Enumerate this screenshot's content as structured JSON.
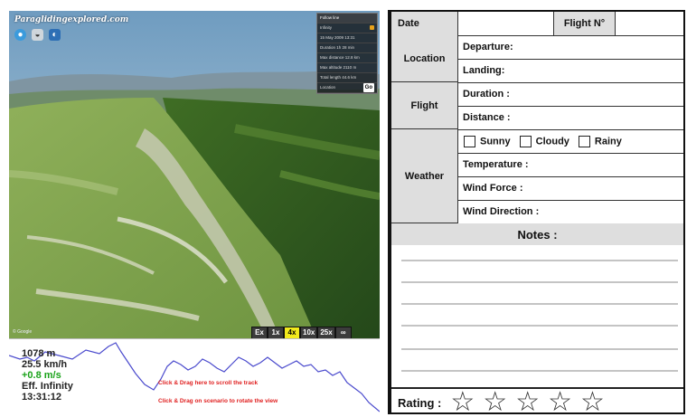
{
  "viewer": {
    "logo_text": "Paraglidingexplored.com",
    "info_panel": {
      "rows": [
        "Follow line",
        "Infinity",
        "15 May 2009 13:31",
        "Duration 1h 28 min",
        "Max distance 12.8 km",
        "Max altitude 2110 m",
        "Total length 44.6 km"
      ],
      "location_label": "Location",
      "location_button": "Go"
    },
    "copyright": "© Google",
    "speed_buttons": [
      "Ex",
      "1x",
      "4x",
      "10x",
      "25x",
      "∞"
    ],
    "speed_active_index": 2,
    "colors": {
      "sky": "#a8c3d8",
      "terrain_green": "#5c8a2c",
      "active_speed": "#f2ea1c"
    }
  },
  "profile": {
    "stats": {
      "altitude": "1078 m",
      "speed": "25.5 km/h",
      "vario": "+0.8 m/s",
      "efficiency": "Eff. Infinity",
      "time": "13:31:12"
    },
    "hint_scroll": "Click & Drag here to scroll the track",
    "hint_rotate": "Click & Drag on scenario to rotate the view",
    "colors": {
      "line": "#4a4acd",
      "vario": "#1aa21a",
      "hint": "#e02020"
    }
  },
  "logbook": {
    "date_label": "Date",
    "flight_no_label": "Flight N°",
    "location_label": "Location",
    "departure_label": "Departure:",
    "landing_label": "Landing:",
    "flight_label": "Flight",
    "duration_label": "Duration :",
    "distance_label": "Distance :",
    "weather_label": "Weather",
    "weather_options": [
      "Sunny",
      "Cloudy",
      "Rainy"
    ],
    "temperature_label": "Temperature :",
    "wind_force_label": "Wind Force :",
    "wind_direction_label": "Wind Direction :",
    "notes_label": "Notes :",
    "rating_label": "Rating :",
    "rating_stars": 5,
    "colors": {
      "shade": "#dedede",
      "border": "#111111"
    }
  }
}
